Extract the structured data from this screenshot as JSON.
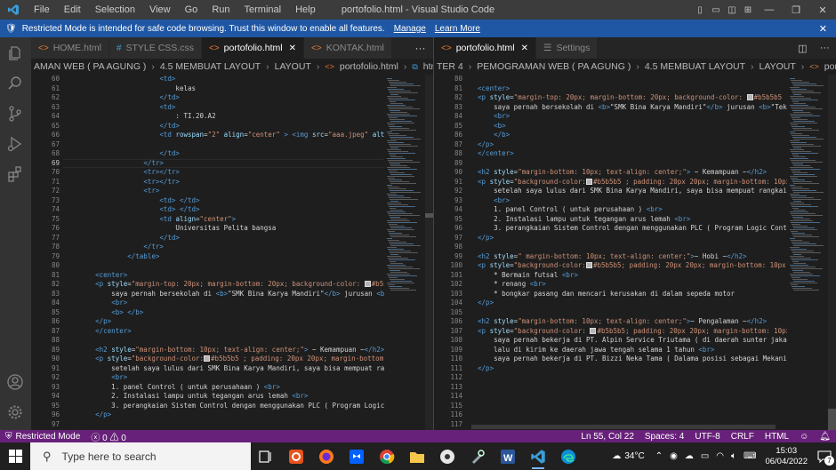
{
  "titlebar": {
    "menu": [
      "File",
      "Edit",
      "Selection",
      "View",
      "Go",
      "Run",
      "Terminal",
      "Help"
    ],
    "title": "portofolio.html - Visual Studio Code"
  },
  "banner": {
    "text": "Restricted Mode is intended for safe code browsing. Trust this window to enable all features.",
    "manage": "Manage",
    "learn": "Learn More"
  },
  "left_group": {
    "tabs": [
      {
        "label": "HOME.html",
        "type": "html",
        "active": false
      },
      {
        "label": "STYLE CSS.css",
        "type": "css",
        "active": false
      },
      {
        "label": "portofolio.html",
        "type": "html",
        "active": true
      },
      {
        "label": "KONTAK.html",
        "type": "html",
        "active": false
      }
    ],
    "more": "···",
    "breadcrumb": [
      "AMAN WEB ( PA AGUNG )",
      "4.5 MEMBUAT LAYOUT",
      "LAYOUT",
      "portofolio.html",
      "html",
      "body",
      "table",
      "tr"
    ]
  },
  "right_group": {
    "tabs": [
      {
        "label": "portofolio.html",
        "type": "html",
        "active": true
      },
      {
        "label": "Settings",
        "type": "settings",
        "active": false
      }
    ],
    "breadcrumb": [
      "TER 4",
      "PEMOGRAMAN WEB ( PA AGUNG )",
      "4.5 MEMBUAT LAYOUT",
      "LAYOUT",
      "portofolio.html",
      "html"
    ]
  },
  "left_code": [
    {
      "n": "60",
      "h": "                        <span class=\"t\">&lt;td&gt;</span>"
    },
    {
      "n": "61",
      "h": "                            kelas"
    },
    {
      "n": "62",
      "h": "                        <span class=\"t\">&lt;/td&gt;</span>"
    },
    {
      "n": "63",
      "h": "                        <span class=\"t\">&lt;td&gt;</span>"
    },
    {
      "n": "64",
      "h": "                            : TI.20.A2"
    },
    {
      "n": "65",
      "h": "                        <span class=\"t\">&lt;/td&gt;</span>"
    },
    {
      "n": "66",
      "h": "                        <span class=\"t\">&lt;td</span> <span class=\"a\">rowspan</span>=<span class=\"s\">\"2\"</span> <span class=\"a\">align</span>=<span class=\"s\">\"center\"</span> <span class=\"t\">&gt;</span> <span class=\"t\">&lt;img</span> <span class=\"a\">src</span>=<span class=\"s\">\"aaa.jpeg\"</span> <span class=\"a\">alt</span>=<span class=\"s\">\"\"</span> <span class=\"a\">width</span>=<span class=\"s\">\"200\"</span>"
    },
    {
      "n": "67",
      "h": ""
    },
    {
      "n": "68",
      "h": "                        <span class=\"t\">&lt;/td&gt;</span>"
    },
    {
      "n": "69",
      "h": "                    <span class=\"t\">&lt;/tr&gt;</span>",
      "cur": true
    },
    {
      "n": "70",
      "h": "                    <span class=\"t\">&lt;tr&gt;&lt;/tr&gt;</span>"
    },
    {
      "n": "71",
      "h": "                    <span class=\"t\">&lt;tr&gt;&lt;/tr&gt;</span>"
    },
    {
      "n": "72",
      "h": "                    <span class=\"t\">&lt;tr&gt;</span>"
    },
    {
      "n": "73",
      "h": "                        <span class=\"t\">&lt;td&gt;</span> <span class=\"t\">&lt;/td&gt;</span>"
    },
    {
      "n": "74",
      "h": "                        <span class=\"t\">&lt;td&gt;</span> <span class=\"t\">&lt;/td&gt;</span>"
    },
    {
      "n": "75",
      "h": "                        <span class=\"t\">&lt;td</span> <span class=\"a\">align</span>=<span class=\"s\">\"center\"</span><span class=\"t\">&gt;</span>"
    },
    {
      "n": "76",
      "h": "                            Universitas Pelita bangsa"
    },
    {
      "n": "77",
      "h": "                        <span class=\"t\">&lt;/td&gt;</span>"
    },
    {
      "n": "78",
      "h": "                    <span class=\"t\">&lt;/tr&gt;</span>"
    },
    {
      "n": "79",
      "h": "                <span class=\"t\">&lt;/table&gt;</span>"
    },
    {
      "n": "80",
      "h": ""
    },
    {
      "n": "81",
      "h": "        <span class=\"t\">&lt;center&gt;</span>"
    },
    {
      "n": "82",
      "h": "        <span class=\"t\">&lt;p</span> <span class=\"a\">style</span>=<span class=\"s\">\"margin-top: 20px; margin-bottom: 20px; background-color: <i class=\"sw\"></i>#b5b5b5 ; padding: 20px\"</span>"
    },
    {
      "n": "83",
      "h": "            saya pernah bersekolah di <span class=\"t\">&lt;b&gt;</span>\"SMK Bina Karya Mandiri\"<span class=\"t\">&lt;/b&gt;</span> jurusan <span class=\"t\">&lt;b&gt;</span>\"Tekhnik L"
    },
    {
      "n": "84",
      "h": "            <span class=\"t\">&lt;br&gt;</span>"
    },
    {
      "n": "85",
      "h": "            <span class=\"t\">&lt;b&gt;</span> <span class=\"t\">&lt;/b&gt;</span>"
    },
    {
      "n": "86",
      "h": "        <span class=\"t\">&lt;/p&gt;</span>"
    },
    {
      "n": "87",
      "h": "        <span class=\"t\">&lt;/center&gt;</span>"
    },
    {
      "n": "88",
      "h": ""
    },
    {
      "n": "89",
      "h": "        <span class=\"t\">&lt;h2</span> <span class=\"a\">style</span>=<span class=\"s\">\"margin-bottom: 10px; text-align: center;\"</span><span class=\"t\">&gt;</span> ~ Kemampuan ~<span class=\"t\">&lt;/h2&gt;</span>"
    },
    {
      "n": "90",
      "h": "        <span class=\"t\">&lt;p</span> <span class=\"a\">style</span>=<span class=\"s\">\"background-color:<i class=\"sw\"></i>#b5b5b5 ; padding: 20px 20px; margin-bottom: 10px;\"</span> <span class=\"t\">&gt;</span>"
    },
    {
      "n": "91",
      "h": "            setelah saya lulus dari SMK Bina Karya Mandiri, saya bisa mempuat rangkaian ;"
    },
    {
      "n": "92",
      "h": "            <span class=\"t\">&lt;br&gt;</span>"
    },
    {
      "n": "93",
      "h": "            1. panel Control ( untuk perusahaan ) <span class=\"t\">&lt;br&gt;</span>"
    },
    {
      "n": "94",
      "h": "            2. Instalasi lampu untuk tegangan arus lemah <span class=\"t\">&lt;br&gt;</span>"
    },
    {
      "n": "95",
      "h": "            3. perangkaian Sistem Control dengan menggunakan PLC ( Program Logic Control)"
    },
    {
      "n": "96",
      "h": "        <span class=\"t\">&lt;/p&gt;</span>"
    },
    {
      "n": "97",
      "h": ""
    },
    {
      "n": "98",
      "h": "        <span class=\"t\">&lt;h2</span> <span class=\"a\">style</span>=<span class=\"s\">\" margin-bottom: 10px; text-align: center;\"</span><span class=\"t\">&gt;</span>~ Hobi ~<span class=\"t\">&lt;/h2&gt;</span>"
    }
  ],
  "right_code": [
    {
      "n": "80",
      "h": ""
    },
    {
      "n": "81",
      "h": "  <span class=\"t\">&lt;center&gt;</span>"
    },
    {
      "n": "82",
      "h": "  <span class=\"t\">&lt;p</span> <span class=\"a\">style</span>=<span class=\"s\">\"margin-top: 20px; margin-bottom: 20px; background-color: <i class=\"sw\"></i>#b5b5b5 ; padd</span>"
    },
    {
      "n": "83",
      "h": "      saya pernah bersekolah di <span class=\"t\">&lt;b&gt;</span>\"SMK Bina Karya Mandiri\"<span class=\"t\">&lt;/b&gt;</span> jurusan <span class=\"t\">&lt;b&gt;</span>\"Tekhnik L"
    },
    {
      "n": "84",
      "h": "      <span class=\"t\">&lt;br&gt;</span>"
    },
    {
      "n": "85",
      "h": "      <span class=\"t\">&lt;b&gt;</span>"
    },
    {
      "n": "86",
      "h": "      <span class=\"t\">&lt;/b&gt;</span>"
    },
    {
      "n": "87",
      "h": "  <span class=\"t\">&lt;/p&gt;</span>"
    },
    {
      "n": "88",
      "h": "  <span class=\"t\">&lt;/center&gt;</span>"
    },
    {
      "n": "89",
      "h": ""
    },
    {
      "n": "90",
      "h": "  <span class=\"t\">&lt;h2</span> <span class=\"a\">style</span>=<span class=\"s\">\"margin-bottom: 10px; text-align: center;\"</span><span class=\"t\">&gt;</span> ~ Kemampuan ~<span class=\"t\">&lt;/h2&gt;</span>"
    },
    {
      "n": "91",
      "h": "  <span class=\"t\">&lt;p</span> <span class=\"a\">style</span>=<span class=\"s\">\"background-color:<i class=\"sw\"></i>#b5b5b5 ; padding: 20px 20px; margin-bottom: 10px;\"</span> <span class=\"t\">&gt;</span>"
    },
    {
      "n": "92",
      "h": "      setelah saya lulus dari SMK Bina Karya Mandiri, saya bisa mempuat rangkaian ;"
    },
    {
      "n": "93",
      "h": "      <span class=\"t\">&lt;br&gt;</span>"
    },
    {
      "n": "94",
      "h": "      1. panel Control ( untuk perusahaan ) <span class=\"t\">&lt;br&gt;</span>"
    },
    {
      "n": "95",
      "h": "      2. Instalasi lampu untuk tegangan arus lemah <span class=\"t\">&lt;br&gt;</span>"
    },
    {
      "n": "96",
      "h": "      3. perangkaian Sistem Control dengan menggunakan PLC ( Program Logic Control)"
    },
    {
      "n": "97",
      "h": "  <span class=\"t\">&lt;/p&gt;</span>"
    },
    {
      "n": "98",
      "h": ""
    },
    {
      "n": "99",
      "h": "  <span class=\"t\">&lt;h2</span> <span class=\"a\">style</span>=<span class=\"s\">\" margin-bottom: 10px; text-align: center;\"</span><span class=\"t\">&gt;</span>~ Hobi ~<span class=\"t\">&lt;/h2&gt;</span>"
    },
    {
      "n": "100",
      "h": "  <span class=\"t\">&lt;p</span> <span class=\"a\">style</span>=<span class=\"s\">\"background-color:<i class=\"sw\"></i>#b5b5b5; padding: 20px 20px; margin-bottom: 10px;\"</span><span class=\"t\">&gt;</span>"
    },
    {
      "n": "101",
      "h": "      * Bermain futsal <span class=\"t\">&lt;br&gt;</span>"
    },
    {
      "n": "102",
      "h": "      * renang <span class=\"t\">&lt;br&gt;</span>"
    },
    {
      "n": "103",
      "h": "      * bongkar pasang dan mencari kerusakan di dalam sepeda motor"
    },
    {
      "n": "104",
      "h": "  <span class=\"t\">&lt;/p&gt;</span>"
    },
    {
      "n": "105",
      "h": ""
    },
    {
      "n": "106",
      "h": "  <span class=\"t\">&lt;h2</span> <span class=\"a\">style</span>=<span class=\"s\">\"margin-bottom: 10px; text-align: center;\"</span><span class=\"t\">&gt;</span>~ Pengalaman ~<span class=\"t\">&lt;/h2&gt;</span>"
    },
    {
      "n": "107",
      "h": "  <span class=\"t\">&lt;p</span> <span class=\"a\">style</span>=<span class=\"s\">\"background-color: <i class=\"sw\"></i>#b5b5b5; padding: 20px 20px; margin-bottom: 10px;\"</span><span class=\"t\">&gt;</span>"
    },
    {
      "n": "108",
      "h": "      saya pernah bekerja di PT. Alpin Service Triutama ( di daerah sunter jakarta)."
    },
    {
      "n": "109",
      "h": "      lalu di kirim ke daerah jawa tengah selama 1 tahun <span class=\"t\">&lt;br&gt;</span>"
    },
    {
      "n": "110",
      "h": "      saya pernah bekerja di PT. Bizzi Neka Tama ( Dalama posisi sebagai Mekanikal &amp; c"
    },
    {
      "n": "111",
      "h": "  <span class=\"t\">&lt;/p&gt;</span>"
    },
    {
      "n": "112",
      "h": ""
    },
    {
      "n": "113",
      "h": ""
    },
    {
      "n": "114",
      "h": ""
    },
    {
      "n": "115",
      "h": ""
    },
    {
      "n": "116",
      "h": ""
    },
    {
      "n": "117",
      "h": ""
    },
    {
      "n": "118",
      "h": ""
    }
  ],
  "status": {
    "restricted": "Restricted Mode",
    "problems": "0",
    "warnings": "0",
    "position": "Ln 55, Col 22",
    "spaces": "Spaces: 4",
    "encoding": "UTF-8",
    "eol": "CRLF",
    "language": "HTML"
  },
  "taskbar": {
    "search_placeholder": "Type here to search",
    "temperature": "34°C",
    "time": "15:03",
    "date": "06/04/2022",
    "notifications": "7"
  },
  "colors": {
    "accent": "#1f57a4",
    "status": "#68217a",
    "swatch": "#b5b5b5"
  }
}
